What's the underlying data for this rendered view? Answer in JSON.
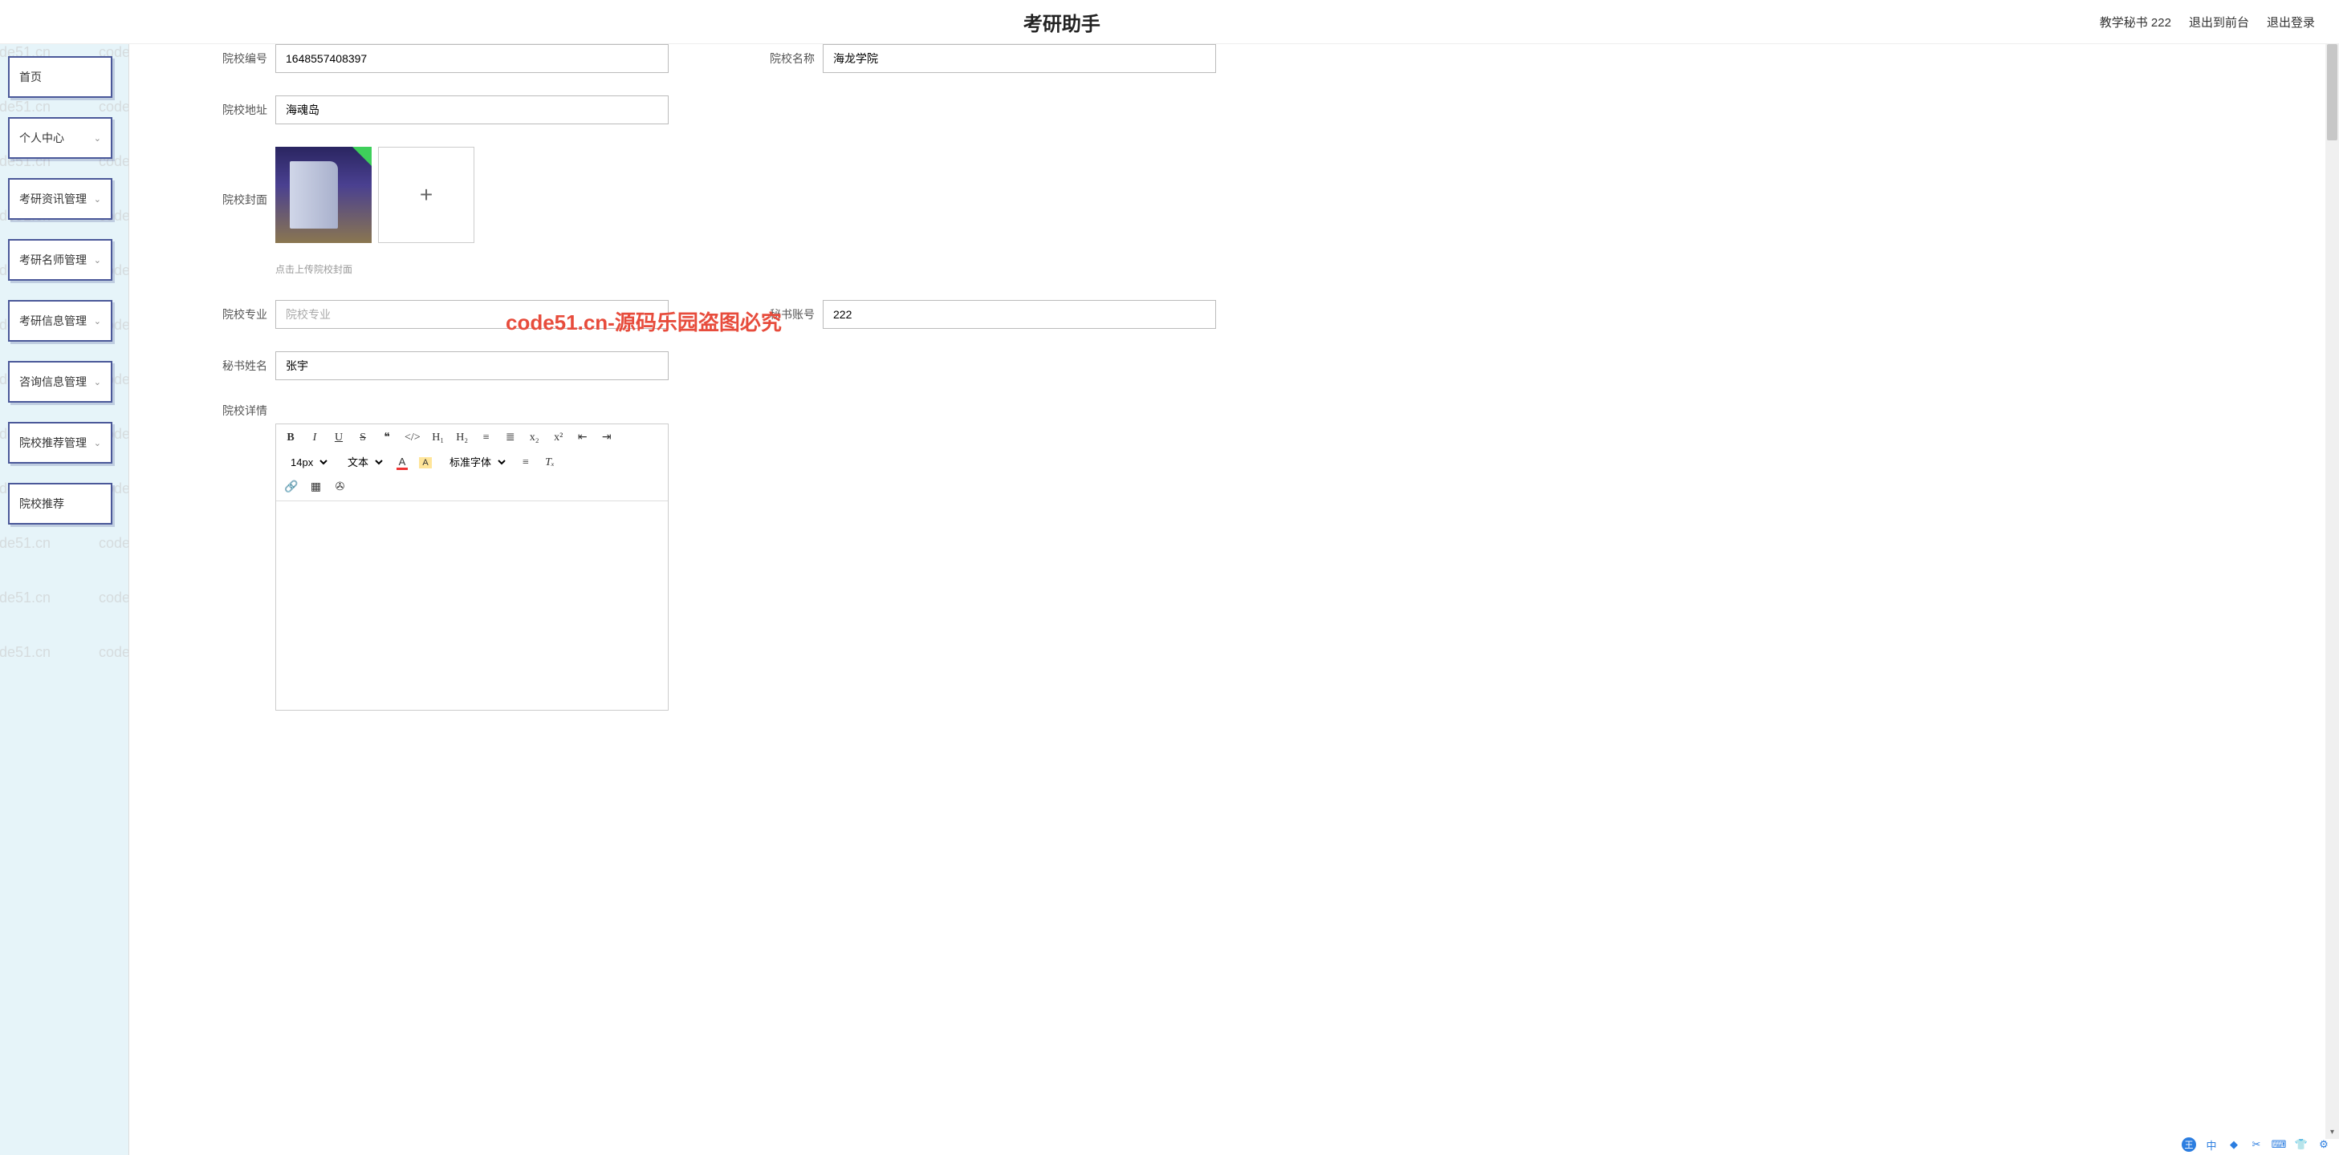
{
  "header": {
    "title": "考研助手",
    "user_role": "教学秘书 222",
    "back_link": "退出到前台",
    "logout": "退出登录"
  },
  "sidebar": {
    "items": [
      {
        "label": "首页",
        "has_children": false
      },
      {
        "label": "个人中心",
        "has_children": true
      },
      {
        "label": "考研资讯管理",
        "has_children": true
      },
      {
        "label": "考研名师管理",
        "has_children": true
      },
      {
        "label": "考研信息管理",
        "has_children": true
      },
      {
        "label": "咨询信息管理",
        "has_children": true
      },
      {
        "label": "院校推荐管理",
        "has_children": true
      },
      {
        "label": "院校推荐",
        "has_children": false
      }
    ]
  },
  "form": {
    "school_id": {
      "label": "院校编号",
      "value": "1648557408397"
    },
    "school_name": {
      "label": "院校名称",
      "value": "海龙学院"
    },
    "school_addr": {
      "label": "院校地址",
      "value": "海魂岛"
    },
    "school_cover": {
      "label": "院校封面",
      "hint": "点击上传院校封面"
    },
    "school_major": {
      "label": "院校专业",
      "value": "",
      "placeholder": "院校专业"
    },
    "sec_account": {
      "label": "秘书账号",
      "value": "222"
    },
    "sec_name": {
      "label": "秘书姓名",
      "value": "张宇"
    },
    "school_detail": {
      "label": "院校详情"
    }
  },
  "editor": {
    "font_size": "14px",
    "block": "文本",
    "font_family": "标准字体",
    "icons": {
      "bold": "B",
      "italic": "I",
      "underline": "U",
      "strike": "S",
      "quote": "❝",
      "code": "</>",
      "h1": "H₁",
      "h2": "H₂",
      "ol": "≡",
      "ul": "≣",
      "sub": "x₂",
      "sup": "x²",
      "indent_dec": "⇤",
      "indent_inc": "⇥",
      "color": "A",
      "hilite": "A",
      "align": "≡",
      "clear": "Tₓ",
      "link": "🔗",
      "image": "▦",
      "save": "✇"
    }
  },
  "watermark": {
    "text": "code51.cn",
    "big": "code51.cn-源码乐园盗图必究"
  },
  "tray": {
    "items": [
      "王",
      "中",
      "◆",
      "✂",
      "⌨",
      "👕",
      "⚙"
    ]
  }
}
